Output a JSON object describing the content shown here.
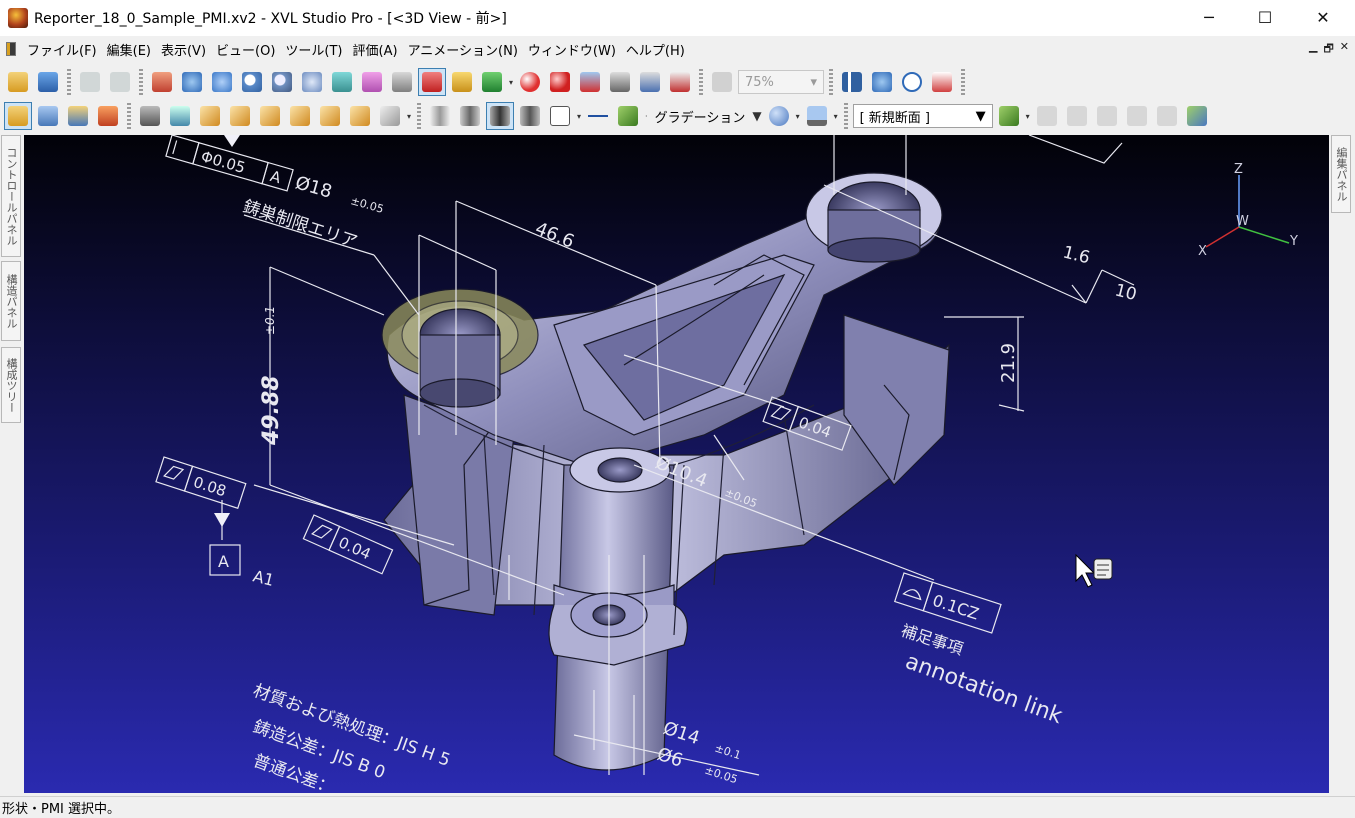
{
  "window": {
    "title": "Reporter_18_0_Sample_PMI.xv2 - XVL Studio Pro - [<3D View - 前>]",
    "controls": {
      "minimize": "─",
      "maximize": "☐",
      "close": "✕"
    }
  },
  "menu": {
    "items": [
      "ファイル(F)",
      "編集(E)",
      "表示(V)",
      "ビュー(O)",
      "ツール(T)",
      "評価(A)",
      "アニメーション(N)",
      "ウィンドウ(W)",
      "ヘルプ(H)"
    ],
    "mdi_controls": {
      "minimize": "▁",
      "restore": "🗗",
      "close": "✕"
    }
  },
  "toolbar": {
    "zoom_value": "75%",
    "shading_label": "グラデーション",
    "section_value": "[ 新規断面 ]"
  },
  "side_panels": {
    "left": [
      "コントロールパネル",
      "構造パネル",
      "構成ツリー"
    ],
    "right": [
      "編集パネル"
    ]
  },
  "viewport": {
    "axes": {
      "z": "Z",
      "w": "W",
      "x": "X",
      "y": "Y"
    },
    "pmi": {
      "fcf_top": {
        "tol": "Φ0.05",
        "datum": "A"
      },
      "dia18": "Ø18",
      "dia18_tol": "±0.05",
      "restriction_area": "鋳巣制限エリア",
      "dim_46_6": "46.6",
      "dim_49_88": "49.88",
      "dim_49_88_tol": "±0.1",
      "roughness_1_6": "1.6",
      "roughness_10": "10",
      "dim_21_9": "21.9",
      "flatness_right": "0.04",
      "dia10_4": "Ø10.4",
      "dia10_4_tol": "±0.05",
      "flatness_left": "0.08",
      "datum_a": "A",
      "datum_a1": "A1",
      "flatness_bottom": "0.04",
      "profile_tol": "0.1CZ",
      "supplement": "補足事項",
      "annotation_link": "annotation link",
      "material_note": "材質および熱処理：JIS H 5",
      "casting_tol_note": "鋳造公差：JIS B 0",
      "general_tol_note": "普通公差：",
      "dia14": "Ø14",
      "dia14_tol": "±0.1",
      "dia6": "Ø6",
      "dia6_tol": "±0.05"
    }
  },
  "status": {
    "text": "形状・PMI 選択中。"
  }
}
